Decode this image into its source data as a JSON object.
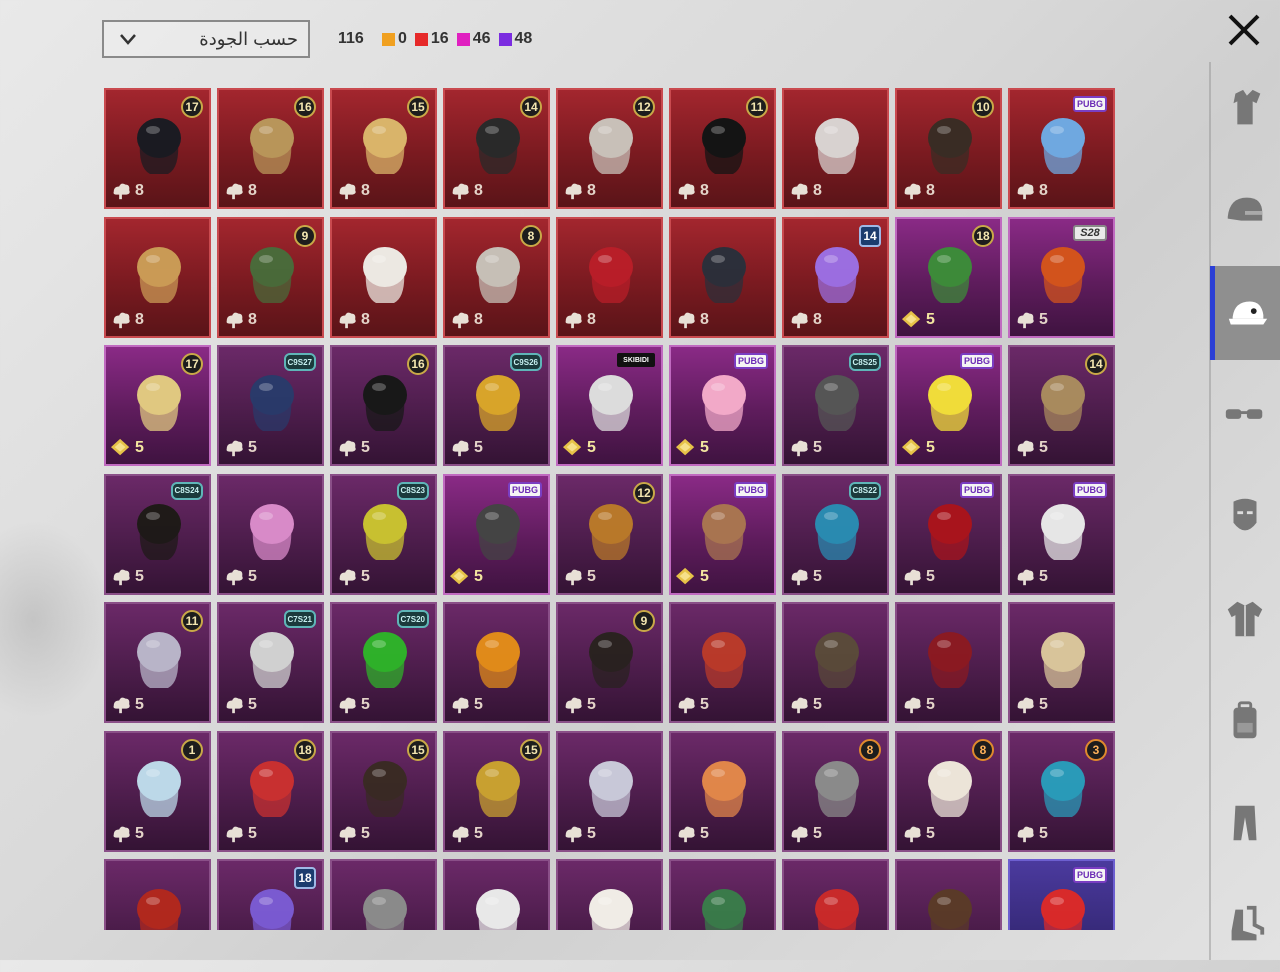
{
  "header": {
    "sort_select": {
      "value": "حسب الجودة"
    },
    "total_count": "116",
    "counters": [
      {
        "color": "#f0a020",
        "value": "0"
      },
      {
        "color": "#e62929",
        "value": "16"
      },
      {
        "color": "#e020c0",
        "value": "46"
      },
      {
        "color": "#7b2ce0",
        "value": "48"
      }
    ]
  },
  "sidebar": {
    "tabs": [
      {
        "name": "outfit-tab",
        "icon": "outfit-icon",
        "active": false
      },
      {
        "name": "helmet-tab",
        "icon": "helmet-icon",
        "active": false
      },
      {
        "name": "hat-tab",
        "icon": "cap-icon",
        "active": true
      },
      {
        "name": "glasses-tab",
        "icon": "glasses-icon",
        "active": false
      },
      {
        "name": "mask-tab",
        "icon": "mask-icon",
        "active": false
      },
      {
        "name": "jacket-tab",
        "icon": "jacket-icon",
        "active": false
      },
      {
        "name": "backpack-tab",
        "icon": "backpack-icon",
        "active": false
      },
      {
        "name": "pants-tab",
        "icon": "pants-icon",
        "active": false
      },
      {
        "name": "shoes-tab",
        "icon": "shoes-icon",
        "active": false
      }
    ]
  },
  "items": [
    {
      "bg": "red",
      "badge": "17",
      "badge_type": "level",
      "currency": "cloud",
      "count": "8",
      "art": "#1b1b22"
    },
    {
      "bg": "red",
      "badge": "16",
      "badge_type": "level",
      "currency": "cloud",
      "count": "8",
      "art": "#b8955a"
    },
    {
      "bg": "red",
      "badge": "15",
      "badge_type": "level",
      "currency": "cloud",
      "count": "8",
      "art": "#d9b46a"
    },
    {
      "bg": "red",
      "badge": "14",
      "badge_type": "level",
      "currency": "cloud",
      "count": "8",
      "art": "#2a2a2a"
    },
    {
      "bg": "red",
      "badge": "12",
      "badge_type": "level",
      "currency": "cloud",
      "count": "8",
      "art": "#c8c0b8"
    },
    {
      "bg": "red",
      "badge": "11",
      "badge_type": "level",
      "currency": "cloud",
      "count": "8",
      "art": "#141414"
    },
    {
      "bg": "red",
      "badge": "",
      "badge_type": "none",
      "currency": "cloud",
      "count": "8",
      "art": "#d8d2d0"
    },
    {
      "bg": "red",
      "badge": "10",
      "badge_type": "level",
      "currency": "cloud",
      "count": "8",
      "art": "#3a2c24"
    },
    {
      "bg": "red",
      "badge": "PUBG",
      "badge_type": "tag",
      "currency": "cloud",
      "count": "8",
      "art": "#6fa8e0"
    },
    {
      "bg": "red",
      "badge": "",
      "badge_type": "none",
      "currency": "cloud",
      "count": "8",
      "art": "#c99a55"
    },
    {
      "bg": "red",
      "badge": "9",
      "badge_type": "level",
      "currency": "cloud",
      "count": "8",
      "art": "#4a6a3a"
    },
    {
      "bg": "red",
      "badge": "",
      "badge_type": "none",
      "currency": "cloud",
      "count": "8",
      "art": "#ece8e2"
    },
    {
      "bg": "red",
      "badge": "8",
      "badge_type": "level",
      "currency": "cloud",
      "count": "8",
      "art": "#c6bfb6"
    },
    {
      "bg": "red",
      "badge": "",
      "badge_type": "none",
      "currency": "cloud",
      "count": "8",
      "art": "#b81e28"
    },
    {
      "bg": "red",
      "badge": "",
      "badge_type": "none",
      "currency": "cloud",
      "count": "8",
      "art": "#2c2f3a"
    },
    {
      "bg": "red",
      "badge": "14",
      "badge_type": "shield",
      "currency": "cloud",
      "count": "8",
      "art": "#9b6ee0"
    },
    {
      "bg": "purple",
      "badge": "18",
      "badge_type": "level",
      "currency": "gold",
      "count": "5",
      "art": "#3d8a3a"
    },
    {
      "bg": "purple",
      "badge": "S28",
      "badge_type": "s28",
      "currency": "cloud",
      "count": "5",
      "art": "#d2531c"
    },
    {
      "bg": "purple",
      "badge": "17",
      "badge_type": "level",
      "currency": "gold",
      "count": "5",
      "art": "#e0c880"
    },
    {
      "bg": "purple-dark",
      "badge": "C9S27",
      "badge_type": "season",
      "currency": "cloud",
      "count": "5",
      "art": "#2a3a6a"
    },
    {
      "bg": "purple-dark",
      "badge": "16",
      "badge_type": "level",
      "currency": "cloud",
      "count": "5",
      "art": "#181818"
    },
    {
      "bg": "purple-dark",
      "badge": "C9S26",
      "badge_type": "season",
      "currency": "cloud",
      "count": "5",
      "art": "#d8a42a"
    },
    {
      "bg": "purple",
      "badge": "SKIBIDI",
      "badge_type": "skibidi",
      "currency": "gold",
      "count": "5",
      "art": "#dcdcdc"
    },
    {
      "bg": "purple",
      "badge": "PUBG",
      "badge_type": "tag",
      "currency": "gold",
      "count": "5",
      "art": "#f2a9c8"
    },
    {
      "bg": "purple-dark",
      "badge": "C8S25",
      "badge_type": "season",
      "currency": "cloud",
      "count": "5",
      "art": "#555555"
    },
    {
      "bg": "purple",
      "badge": "PUBG",
      "badge_type": "tag",
      "currency": "gold",
      "count": "5",
      "art": "#f0dc3a"
    },
    {
      "bg": "purple-dark",
      "badge": "14",
      "badge_type": "level",
      "currency": "cloud",
      "count": "5",
      "art": "#a88a5e"
    },
    {
      "bg": "purple-dark",
      "badge": "C8S24",
      "badge_type": "season",
      "currency": "cloud",
      "count": "5",
      "art": "#1f1a18"
    },
    {
      "bg": "purple-dark",
      "badge": "",
      "badge_type": "none",
      "currency": "cloud",
      "count": "5",
      "art": "#d88ac8"
    },
    {
      "bg": "purple-dark",
      "badge": "C8S23",
      "badge_type": "season",
      "currency": "cloud",
      "count": "5",
      "art": "#c8c030"
    },
    {
      "bg": "purple",
      "badge": "PUBG",
      "badge_type": "tag",
      "currency": "gold",
      "count": "5",
      "art": "#444444"
    },
    {
      "bg": "purple-dark",
      "badge": "12",
      "badge_type": "level",
      "currency": "cloud",
      "count": "5",
      "art": "#b8782a"
    },
    {
      "bg": "purple",
      "badge": "PUBG",
      "badge_type": "tag",
      "currency": "gold",
      "count": "5",
      "art": "#a87450"
    },
    {
      "bg": "purple-dark",
      "badge": "C8S22",
      "badge_type": "season",
      "currency": "cloud",
      "count": "5",
      "art": "#2a8ab0"
    },
    {
      "bg": "purple-dark",
      "badge": "PUBG",
      "badge_type": "tag",
      "currency": "cloud",
      "count": "5",
      "art": "#a8141c"
    },
    {
      "bg": "purple-dark",
      "badge": "PUBG",
      "badge_type": "tag",
      "currency": "cloud",
      "count": "5",
      "art": "#e6e6e6"
    },
    {
      "bg": "purple-dark",
      "badge": "11",
      "badge_type": "level",
      "currency": "cloud",
      "count": "5",
      "art": "#b8b4c8"
    },
    {
      "bg": "purple-dark",
      "badge": "C7S21",
      "badge_type": "season",
      "currency": "cloud",
      "count": "5",
      "art": "#d0d0d0"
    },
    {
      "bg": "purple-dark",
      "badge": "C7S20",
      "badge_type": "season",
      "currency": "cloud",
      "count": "5",
      "art": "#2fb02a"
    },
    {
      "bg": "purple-dark",
      "badge": "",
      "badge_type": "none",
      "currency": "cloud",
      "count": "5",
      "art": "#e08a1a"
    },
    {
      "bg": "purple-dark",
      "badge": "9",
      "badge_type": "level",
      "currency": "cloud",
      "count": "5",
      "art": "#2a2220"
    },
    {
      "bg": "purple-dark",
      "badge": "",
      "badge_type": "none",
      "currency": "cloud",
      "count": "5",
      "art": "#b83a2a"
    },
    {
      "bg": "purple-dark",
      "badge": "",
      "badge_type": "none",
      "currency": "cloud",
      "count": "5",
      "art": "#5a4a3a"
    },
    {
      "bg": "purple-dark",
      "badge": "",
      "badge_type": "none",
      "currency": "cloud",
      "count": "5",
      "art": "#8a1a22"
    },
    {
      "bg": "purple-dark",
      "badge": "",
      "badge_type": "none",
      "currency": "cloud",
      "count": "5",
      "art": "#d8c49a"
    },
    {
      "bg": "purple-dark",
      "badge": "1",
      "badge_type": "level",
      "currency": "cloud",
      "count": "5",
      "art": "#bcd8e8"
    },
    {
      "bg": "purple-dark",
      "badge": "18",
      "badge_type": "level",
      "currency": "cloud",
      "count": "5",
      "art": "#c83030"
    },
    {
      "bg": "purple-dark",
      "badge": "15",
      "badge_type": "level",
      "currency": "cloud",
      "count": "5",
      "art": "#3a2a24"
    },
    {
      "bg": "purple-dark",
      "badge": "15",
      "badge_type": "level",
      "currency": "cloud",
      "count": "5",
      "art": "#c8a030"
    },
    {
      "bg": "purple-dark",
      "badge": "",
      "badge_type": "none",
      "currency": "cloud",
      "count": "5",
      "art": "#c8c8d8"
    },
    {
      "bg": "purple-dark",
      "badge": "",
      "badge_type": "none",
      "currency": "cloud",
      "count": "5",
      "art": "#e0864a"
    },
    {
      "bg": "purple-dark",
      "badge": "8",
      "badge_type": "orange",
      "currency": "cloud",
      "count": "5",
      "art": "#8a8a8a"
    },
    {
      "bg": "purple-dark",
      "badge": "8",
      "badge_type": "orange",
      "currency": "cloud",
      "count": "5",
      "art": "#ece4d8"
    },
    {
      "bg": "purple-dark",
      "badge": "3",
      "badge_type": "orange",
      "currency": "cloud",
      "count": "5",
      "art": "#2a9ab8"
    },
    {
      "bg": "purple-dark",
      "badge": "",
      "badge_type": "none",
      "currency": "cloud",
      "count": "",
      "art": "#b0281e"
    },
    {
      "bg": "purple-dark",
      "badge": "18",
      "badge_type": "shield",
      "currency": "cloud",
      "count": "",
      "art": "#7a5ad0"
    },
    {
      "bg": "purple-dark",
      "badge": "",
      "badge_type": "none",
      "currency": "cloud",
      "count": "",
      "art": "#8a8a8a"
    },
    {
      "bg": "purple-dark",
      "badge": "",
      "badge_type": "none",
      "currency": "cloud",
      "count": "",
      "art": "#e8e8e8"
    },
    {
      "bg": "purple-dark",
      "badge": "",
      "badge_type": "none",
      "currency": "cloud",
      "count": "",
      "art": "#f0ece6"
    },
    {
      "bg": "purple-dark",
      "badge": "",
      "badge_type": "none",
      "currency": "cloud",
      "count": "",
      "art": "#3a7a4a"
    },
    {
      "bg": "purple-dark",
      "badge": "",
      "badge_type": "none",
      "currency": "cloud",
      "count": "",
      "art": "#c82a2a"
    },
    {
      "bg": "purple-dark",
      "badge": "",
      "badge_type": "none",
      "currency": "cloud",
      "count": "",
      "art": "#5a3a28"
    },
    {
      "bg": "blue",
      "badge": "PUBG",
      "badge_type": "tag",
      "currency": "cloud",
      "count": "",
      "art": "#d82a2a"
    }
  ],
  "colors": {
    "active_tab_accent": "#2b3fd6"
  }
}
